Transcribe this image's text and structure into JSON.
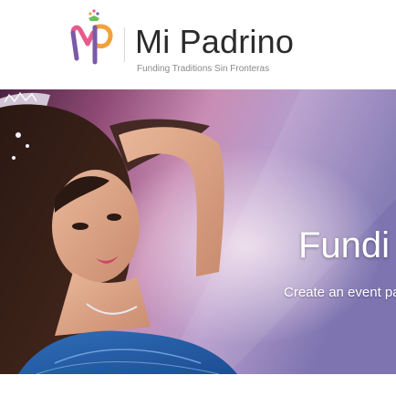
{
  "brand": {
    "name": "Mi Padrino",
    "tagline": "Funding Traditions Sin Fronteras",
    "logo_icon": "mi-padrino-logo-icon",
    "colors": {
      "logo_purple": "#7b5aa6",
      "logo_pink": "#e85a8c",
      "logo_orange": "#f2a23a",
      "logo_green": "#6bbf59",
      "text_dark": "#2b2b2b",
      "text_muted": "#8a8a8a"
    }
  },
  "hero": {
    "title": "Fundi",
    "subtitle": "Create an event page, sh"
  }
}
